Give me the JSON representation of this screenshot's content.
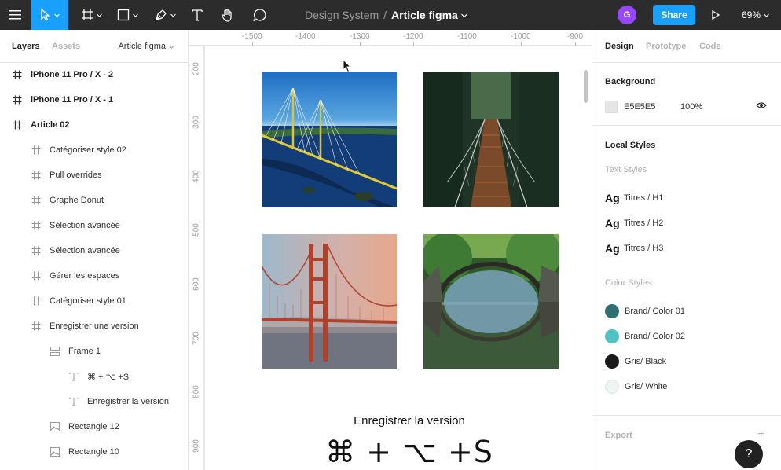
{
  "toolbar": {
    "project": "Design System",
    "separator": "/",
    "file_name": "Article figma",
    "avatar_initial": "G",
    "share_label": "Share",
    "zoom": "69%"
  },
  "layers_panel": {
    "tabs": [
      "Layers",
      "Assets"
    ],
    "page_name": "Article figma",
    "items": [
      {
        "label": "iPhone 11 Pro / X - 2",
        "icon": "frame-icon"
      },
      {
        "label": "iPhone 11 Pro / X - 1",
        "icon": "frame-icon"
      },
      {
        "label": "Article 02",
        "icon": "frame-icon"
      },
      {
        "label": "Catégoriser style 02",
        "icon": "frame-icon"
      },
      {
        "label": "Pull overrides",
        "icon": "frame-icon"
      },
      {
        "label": "Graphe Donut",
        "icon": "frame-icon"
      },
      {
        "label": "Sélection avancée",
        "icon": "frame-icon"
      },
      {
        "label": "Sélection avancée",
        "icon": "frame-icon"
      },
      {
        "label": "Gérer les espaces",
        "icon": "frame-icon"
      },
      {
        "label": "Catégoriser style 01",
        "icon": "frame-icon"
      },
      {
        "label": "Enregistrer une version",
        "icon": "frame-icon"
      },
      {
        "label": "Frame 1",
        "icon": "auto-layout-icon"
      },
      {
        "label": "⌘ + ⌥ +S",
        "icon": "text-icon"
      },
      {
        "label": "Enregistrer la version",
        "icon": "text-icon"
      },
      {
        "label": "Rectangle 12",
        "icon": "image-icon"
      },
      {
        "label": "Rectangle 10",
        "icon": "image-icon"
      }
    ]
  },
  "canvas": {
    "ruler_h": [
      "-1500",
      "-1400",
      "-1300",
      "-1200",
      "-1100",
      "-1000",
      "-900"
    ],
    "ruler_v": [
      "200",
      "300",
      "400",
      "500",
      "600",
      "700",
      "800",
      "900"
    ],
    "images": [
      "cable-stayed-bridge-photo",
      "forest-suspension-bridge-photo",
      "golden-gate-bridge-photo",
      "stone-arch-bridge-photo"
    ],
    "caption": "Enregistrer la version",
    "shortcut": "⌘ + ⌥ +S"
  },
  "design_panel": {
    "tabs": [
      "Design",
      "Prototype",
      "Code"
    ],
    "background_title": "Background",
    "background_hex": "E5E5E5",
    "background_opacity": "100%",
    "local_styles_title": "Local Styles",
    "text_styles_title": "Text Styles",
    "text_styles": [
      {
        "sample": "Ag",
        "name": "Titres / H1"
      },
      {
        "sample": "Ag",
        "name": "Titres / H2"
      },
      {
        "sample": "Ag",
        "name": "Titres / H3"
      }
    ],
    "color_styles_title": "Color Styles",
    "color_styles": [
      {
        "name": "Brand/ Color 01",
        "color": "#2f6f73"
      },
      {
        "name": "Brand/ Color 02",
        "color": "#4fc3c3"
      },
      {
        "name": "Gris/ Black",
        "color": "#1a1a1a"
      },
      {
        "name": "Gris/ White",
        "color": "#eef3f3"
      }
    ],
    "export_label": "Export",
    "help_label": "?"
  },
  "colors": {
    "toolbar_bg": "#2c2c2c",
    "accent": "#18a0fb",
    "canvas_bg": "#e5e5e5"
  }
}
